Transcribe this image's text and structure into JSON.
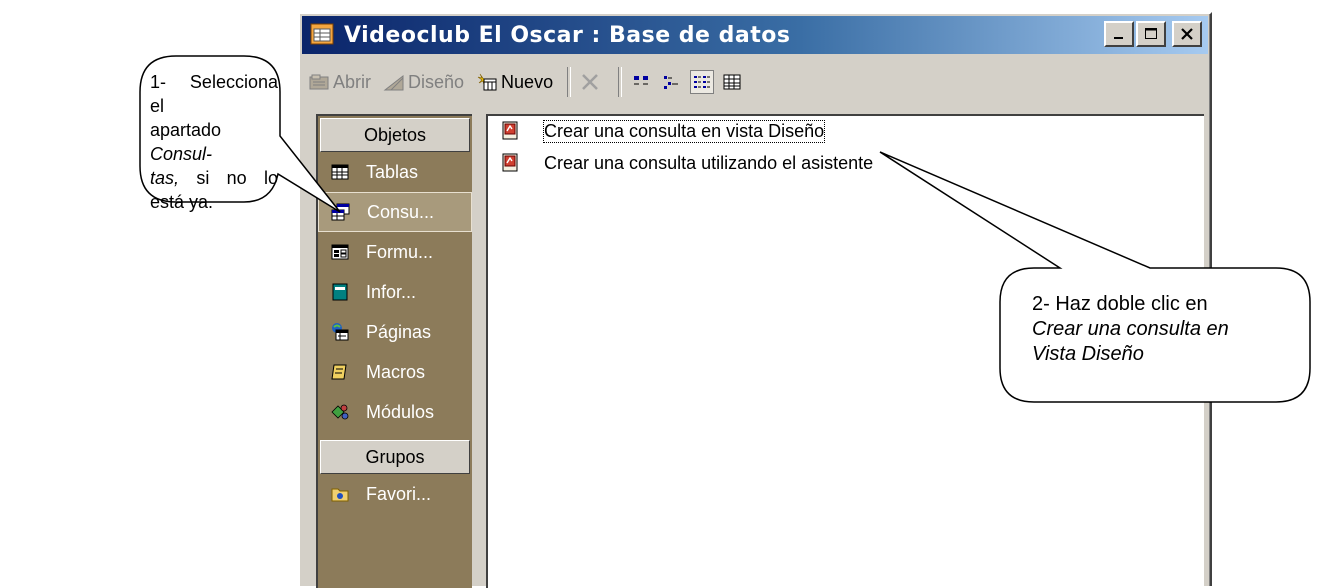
{
  "window": {
    "title": "Videoclub El Oscar : Base de datos",
    "controls": {
      "minimize": "_",
      "maximize": "□",
      "close": "✕"
    }
  },
  "toolbar": {
    "open_label": "Abrir",
    "design_label": "Diseño",
    "new_label": "Nuevo",
    "delete_icon": "x-icon",
    "views": [
      "large-icons",
      "small-icons",
      "list",
      "details"
    ],
    "active_view": "list"
  },
  "objects_pane": {
    "header": "Objetos",
    "items": [
      {
        "label": "Tablas",
        "icon": "table-icon"
      },
      {
        "label": "Consu...",
        "icon": "query-icon",
        "selected": true
      },
      {
        "label": "Formu...",
        "icon": "form-icon"
      },
      {
        "label": "Infor...",
        "icon": "report-icon"
      },
      {
        "label": "Páginas",
        "icon": "page-icon"
      },
      {
        "label": "Macros",
        "icon": "macro-icon"
      },
      {
        "label": "Módulos",
        "icon": "module-icon"
      }
    ],
    "groups_header": "Grupos",
    "groups": [
      {
        "label": "Favori...",
        "icon": "favorites-icon"
      }
    ]
  },
  "list": {
    "items": [
      {
        "label": "Crear una consulta en vista Diseño",
        "icon": "create-query-icon",
        "focused": true
      },
      {
        "label": "Crear una consulta utilizando el asistente",
        "icon": "create-query-icon"
      }
    ]
  },
  "callouts": {
    "first": {
      "line1": "1-  Selecciona  el",
      "line2_a": "apartado  ",
      "line2_b": "Consul-",
      "line3_a": "tas,",
      "line3_b": " si no lo está ya."
    },
    "second": {
      "line1": "2-  Haz  doble  clic  en",
      "line2": "Crear  una  consulta  en",
      "line3": "Vista Diseño"
    }
  },
  "colors": {
    "title_start": "#0a246a",
    "title_end": "#a6caf0",
    "objects_bar": "#8c7b5a",
    "chrome": "#d4d0c8"
  }
}
